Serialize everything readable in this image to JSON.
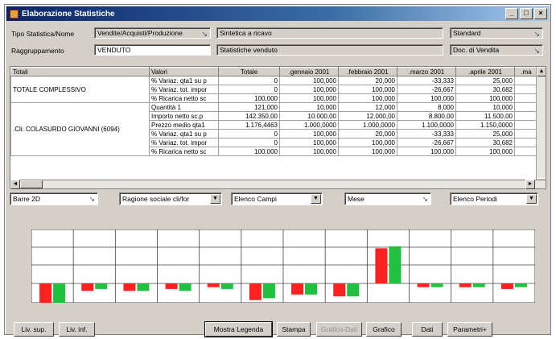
{
  "window": {
    "title": "Elaborazione Statistiche",
    "controls": [
      "_",
      "□",
      "×"
    ]
  },
  "header": {
    "tipo_label": "Tipo Statistica/Nome",
    "tipo_value": "Vendite/Acquisti/Produzione",
    "tipo_desc": "Sintetica a ricavo",
    "tipo_right": "Standard",
    "raggr_label": "Raggruppamento",
    "raggr_value": "VENDUTO",
    "raggr_desc": "Statistiche venduto",
    "raggr_right": "Doc. di Vendita"
  },
  "table": {
    "columns": [
      "Totali",
      "Valori",
      "Totale",
      ".gennaio 2001",
      ".febbraio 2001",
      ".marzo 2001",
      ".aprile 2001",
      ".ma"
    ],
    "groups": [
      {
        "name": "TOTALE COMPLESSIVO",
        "rows": [
          [
            "% Variaz. qta1 su p",
            "0",
            "100,000",
            "20,000",
            "-33,333",
            "25,000"
          ],
          [
            "% Variaz. tot. impor",
            "0",
            "100,000",
            "100,000",
            "-26,667",
            "30,682"
          ],
          [
            "% Ricarica netto sc",
            "100,000",
            "100,000",
            "100,000",
            "100,000",
            "100,000"
          ]
        ]
      },
      {
        "name": ".Cli: COLASURDO GIOVANNI (6094)",
        "rows": [
          [
            "Quantità 1",
            "121,000",
            "10,000",
            "12,000",
            "8,000",
            "10,000"
          ],
          [
            "Importo netto sc.p",
            "142.350,00",
            "10.000,00",
            "12.000,00",
            "8.800,00",
            "11.500,00"
          ],
          [
            "Prezzo medio qta1",
            "1.176,4463",
            "1.000,0000",
            "1.000,0000",
            "1.100,0000",
            "1.150,0000"
          ],
          [
            "% Variaz. qta1 su p",
            "0",
            "100,000",
            "20,000",
            "-33,333",
            "25,000"
          ],
          [
            "% Variaz. tot. impor",
            "0",
            "100,000",
            "100,000",
            "-26,667",
            "30,682"
          ],
          [
            "% Ricarica netto sc",
            "100,000",
            "100,000",
            "100,000",
            "100,000",
            "100,000"
          ]
        ]
      }
    ]
  },
  "selectors": {
    "chart_type": "Barre 2D",
    "series_field": "Ragione sociale cli/for",
    "fields": "Elenco Campi",
    "period": "Mese",
    "periods": "Elenco Periodi"
  },
  "chart_data": {
    "type": "bar",
    "series": [
      {
        "color": "#ff2020",
        "values": [
          -60,
          -20,
          -20,
          -15,
          -10,
          -45,
          -30,
          -35,
          95,
          -10,
          -10,
          -15
        ]
      },
      {
        "color": "#20c040",
        "values": [
          -60,
          -15,
          -20,
          -20,
          -15,
          -40,
          -30,
          -35,
          100,
          -10,
          -10,
          -10
        ]
      }
    ],
    "grid": true
  },
  "buttons": {
    "liv_sup": "Liv. sup.",
    "liv_inf": "Liv. inf.",
    "legenda": "Mostra Legenda",
    "stampa": "Stampa",
    "grafico_dati": "Grafico-Dati",
    "grafico": "Grafico",
    "dati": "Dati",
    "parametri": "Parametri+"
  }
}
